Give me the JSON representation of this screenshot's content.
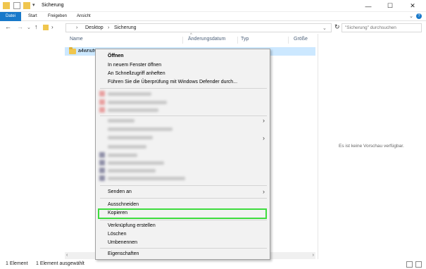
{
  "window": {
    "title": "Sicherung",
    "minimize": "—",
    "maximize": "☐",
    "close": "✕"
  },
  "ribbon": {
    "tabs": [
      "Datei",
      "Start",
      "Freigeben",
      "Ansicht"
    ]
  },
  "address": {
    "separator": "›",
    "crumbs": [
      "Desktop",
      "Sicherung"
    ],
    "search_placeholder": "\"Sicherung\" durchsuchen"
  },
  "columns": [
    "Name",
    "Änderungsdatum",
    "Typ",
    "Größe"
  ],
  "files": [
    {
      "name": "a4wnutvo"
    }
  ],
  "preview": {
    "text": "Es ist keine Vorschau verfügbar."
  },
  "context_menu": {
    "open": "Öffnen",
    "open_new_window": "In neuem Fenster öffnen",
    "pin_quick_access": "An Schnellzugriff anheften",
    "defender_scan": "Führen Sie die Überprüfung mit Windows Defender durch...",
    "send_to": "Senden an",
    "cut": "Ausschneiden",
    "copy": "Kopieren",
    "create_shortcut": "Verknüpfung erstellen",
    "delete": "Löschen",
    "rename": "Umbenennen",
    "properties": "Eigenschaften"
  },
  "status": {
    "count": "1 Element",
    "selected": "1 Element ausgewählt"
  },
  "colors": {
    "accent": "#1979ca",
    "selection": "#cce8ff",
    "highlight_box": "#3ddc3d"
  }
}
